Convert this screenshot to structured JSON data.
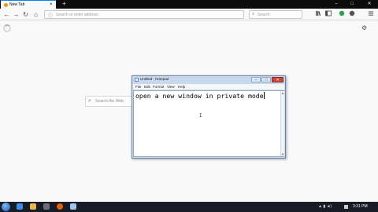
{
  "browser": {
    "tab": {
      "title": "New Tab",
      "close": "×"
    },
    "new_tab": "+",
    "window_buttons": {
      "minimize": "–",
      "maximize": "□",
      "close": "✕"
    }
  },
  "navbar": {
    "back": "←",
    "forward": "→",
    "reload": "↻",
    "home": "⌂",
    "url_placeholder": "Search or enter address",
    "url_icon": "ⓘ",
    "search_placeholder": "Search",
    "search_icon": "⌕"
  },
  "content": {
    "web_search_placeholder": "Search the Web",
    "settings": "⚙"
  },
  "notepad": {
    "title": "Untitled - Notepad",
    "menus": [
      "File",
      "Edit",
      "Format",
      "View",
      "Help"
    ],
    "text": "open a new window in private mode",
    "minimize": "–",
    "maximize": "□",
    "close": "✕"
  },
  "taskbar": {
    "tray_text": "▲ ▮ ◄)",
    "clock": "3:31 PM"
  },
  "colors": {
    "firefox_tab_accent": "#0a84ff",
    "taskbar_bg": "#181c26",
    "notepad_frame": "#c9d9ec",
    "close_red": "#c9483b"
  }
}
